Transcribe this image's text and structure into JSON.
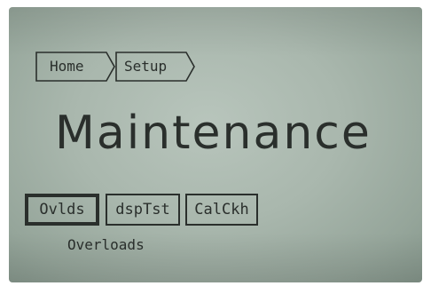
{
  "breadcrumb": {
    "items": [
      {
        "label": "Home"
      },
      {
        "label": "Setup"
      }
    ]
  },
  "page": {
    "title": "Maintenance"
  },
  "softkeys": {
    "items": [
      {
        "label": "Ovlds",
        "selected": true
      },
      {
        "label": "dspTst",
        "selected": false
      },
      {
        "label": "CalCkh",
        "selected": false
      }
    ],
    "selected_description": "Overloads"
  },
  "colors": {
    "lcd_background": "#a9b7ad",
    "lcd_ink": "#2a2f2c"
  }
}
